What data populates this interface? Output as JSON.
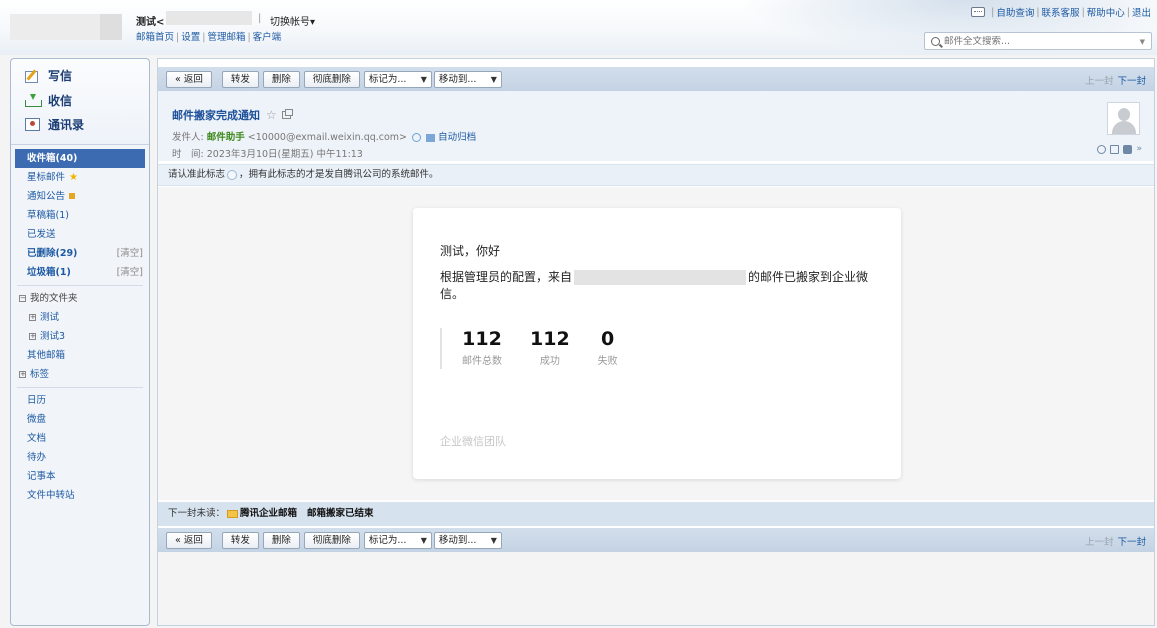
{
  "header": {
    "account_name": "测试<",
    "switch_account": "切换帐号▾",
    "sub_links": [
      "邮箱首页",
      "设置",
      "管理邮箱",
      "客户端"
    ],
    "top_links": [
      "自助查询",
      "联系客服",
      "帮助中心",
      "退出"
    ],
    "search_placeholder": "邮件全文搜索..."
  },
  "sidebar": {
    "write": "写信",
    "inbox": "收信",
    "contacts": "通讯录",
    "folders": {
      "inbox": "收件箱(40)",
      "starred": "星标邮件",
      "notices": "通知公告",
      "drafts": "草稿箱(1)",
      "sent": "已发送",
      "deleted": "已删除(29)",
      "deleted_clear": "[清空]",
      "junk": "垃圾箱(1)",
      "junk_clear": "[清空]",
      "my_folders": "我的文件夹",
      "my_folder_1": "测试",
      "my_folder_2": "测试3",
      "other_mailboxes": "其他邮箱",
      "tags": "标签"
    },
    "apps": [
      "日历",
      "微盘",
      "文档",
      "待办",
      "记事本",
      "文件中转站"
    ]
  },
  "toolbar": {
    "back": "« 返回",
    "forward": "转发",
    "delete": "删除",
    "delete_forever": "彻底删除",
    "mark_as": "标记为...",
    "move_to": "移动到...",
    "prev": "上一封",
    "next": "下一封"
  },
  "mail": {
    "subject": "邮件搬家完成通知",
    "sender_label": "发件人:",
    "sender_name": "邮件助手",
    "sender_email": "<10000@exmail.weixin.qq.com>",
    "auto_archive": "自动归档",
    "time_label": "时　间:",
    "time_value": "2023年3月10日(星期五) 中午11:13",
    "notice_prefix": "请认准此标志",
    "notice_suffix": "，拥有此标志的才是发自腾讯公司的系统邮件。"
  },
  "body": {
    "greeting": "测试，你好",
    "line_prefix": "根据管理员的配置，来自",
    "line_suffix": "的邮件已搬家到企业微信。",
    "stats": [
      {
        "num": "112",
        "label": "邮件总数"
      },
      {
        "num": "112",
        "label": "成功"
      },
      {
        "num": "0",
        "label": "失败"
      }
    ],
    "team": "企业微信团队"
  },
  "next_unread": {
    "label": "下一封未读：",
    "sender": "腾讯企业邮箱",
    "subject": "邮箱搬家已结束"
  }
}
